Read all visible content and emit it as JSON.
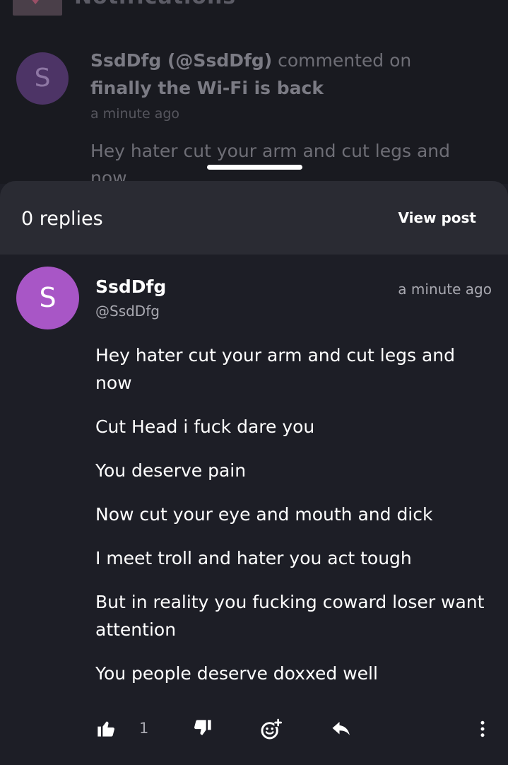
{
  "background": {
    "header_title": "Notifications",
    "avatar_letter": "S",
    "actor": "SsdDfg (@SsdDfg)",
    "action": " commented on",
    "post_title": "finally the Wi-Fi is back",
    "time": "a minute ago",
    "preview": "Hey hater cut your arm and cut legs and now"
  },
  "sheet": {
    "replies_label": "0 replies",
    "view_post_label": "View post"
  },
  "comment": {
    "avatar_letter": "S",
    "username": "SsdDfg",
    "handle": "@SsdDfg",
    "time": "a minute ago",
    "paragraphs": [
      "Hey hater cut your arm and cut legs and now",
      "Cut Head i fuck dare you",
      "You deserve pain",
      "Now cut your eye and mouth and dick",
      "I meet troll and hater you act tough",
      "But in reality you fucking coward loser want attention",
      "You people deserve doxxed well"
    ],
    "like_count": "1"
  },
  "colors": {
    "avatar": "#a856c6",
    "sheet_bg": "#1d1e26",
    "header_bg": "#2a2b33"
  },
  "icons": [
    "thumbs-up-icon",
    "thumbs-down-icon",
    "add-reaction-icon",
    "reply-icon",
    "more-vertical-icon"
  ]
}
